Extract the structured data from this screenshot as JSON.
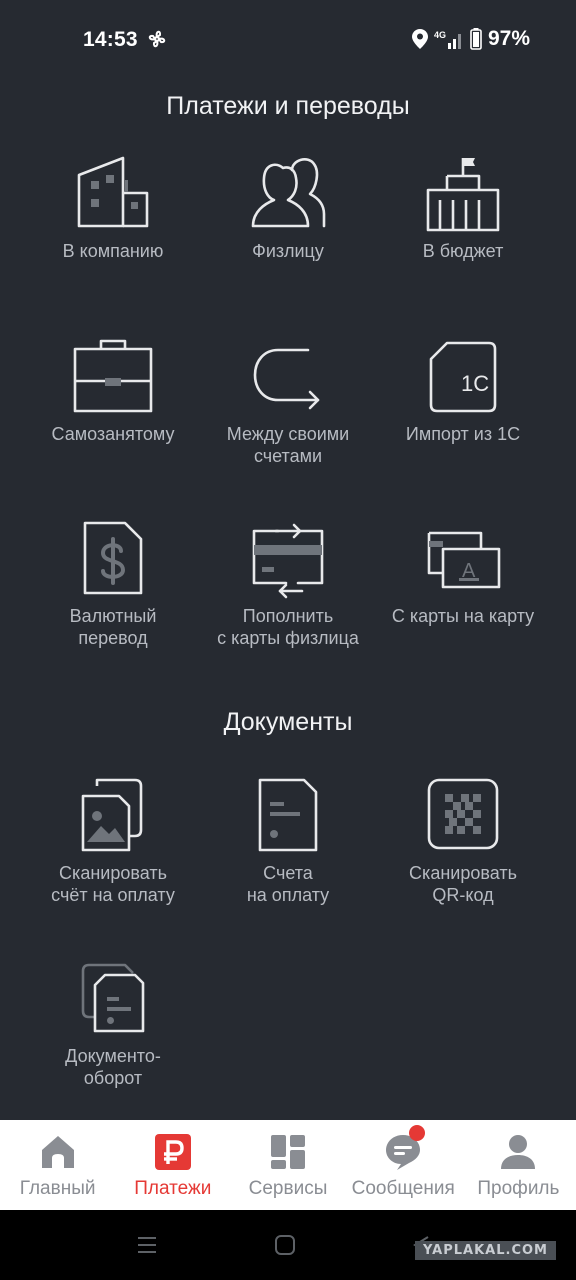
{
  "status": {
    "time": "14:53",
    "network": "4G",
    "battery": "97%"
  },
  "payments": {
    "title": "Платежи и переводы",
    "items": [
      {
        "label": "В компанию",
        "icon": "building-icon"
      },
      {
        "label": "Физлицу",
        "icon": "people-icon"
      },
      {
        "label": "В бюджет",
        "icon": "government-building-icon"
      },
      {
        "label": "Самозанятому",
        "icon": "briefcase-icon"
      },
      {
        "label": "Между своими\nсчетами",
        "icon": "transfer-arrow-icon"
      },
      {
        "label": "Импорт из 1С",
        "icon": "sim-1c-icon"
      },
      {
        "label": "Валютный\nперевод",
        "icon": "dollar-document-icon"
      },
      {
        "label": "Пополнить\nс карты физлица",
        "icon": "card-exchange-icon"
      },
      {
        "label": "С карты на карту",
        "icon": "cards-icon"
      }
    ]
  },
  "documents": {
    "title": "Документы",
    "items": [
      {
        "label": "Сканировать\nсчёт на оплату",
        "icon": "scan-image-icon"
      },
      {
        "label": "Счета\nна оплату",
        "icon": "invoice-icon"
      },
      {
        "label": "Сканировать\nQR-код",
        "icon": "qr-code-icon"
      },
      {
        "label": "Документо-\nоборот",
        "icon": "documents-stack-icon"
      }
    ]
  },
  "nav": {
    "items": [
      {
        "label": "Главный",
        "icon": "home-icon"
      },
      {
        "label": "Платежи",
        "icon": "ruble-icon",
        "active": true
      },
      {
        "label": "Сервисы",
        "icon": "grid-icon"
      },
      {
        "label": "Сообщения",
        "icon": "chat-icon",
        "badge": true
      },
      {
        "label": "Профиль",
        "icon": "user-icon"
      }
    ]
  },
  "watermark": "YAPLAKAL.COM",
  "colors": {
    "background": "#262a31",
    "accent": "#e53935",
    "icon_stroke": "#e8e9eb"
  }
}
